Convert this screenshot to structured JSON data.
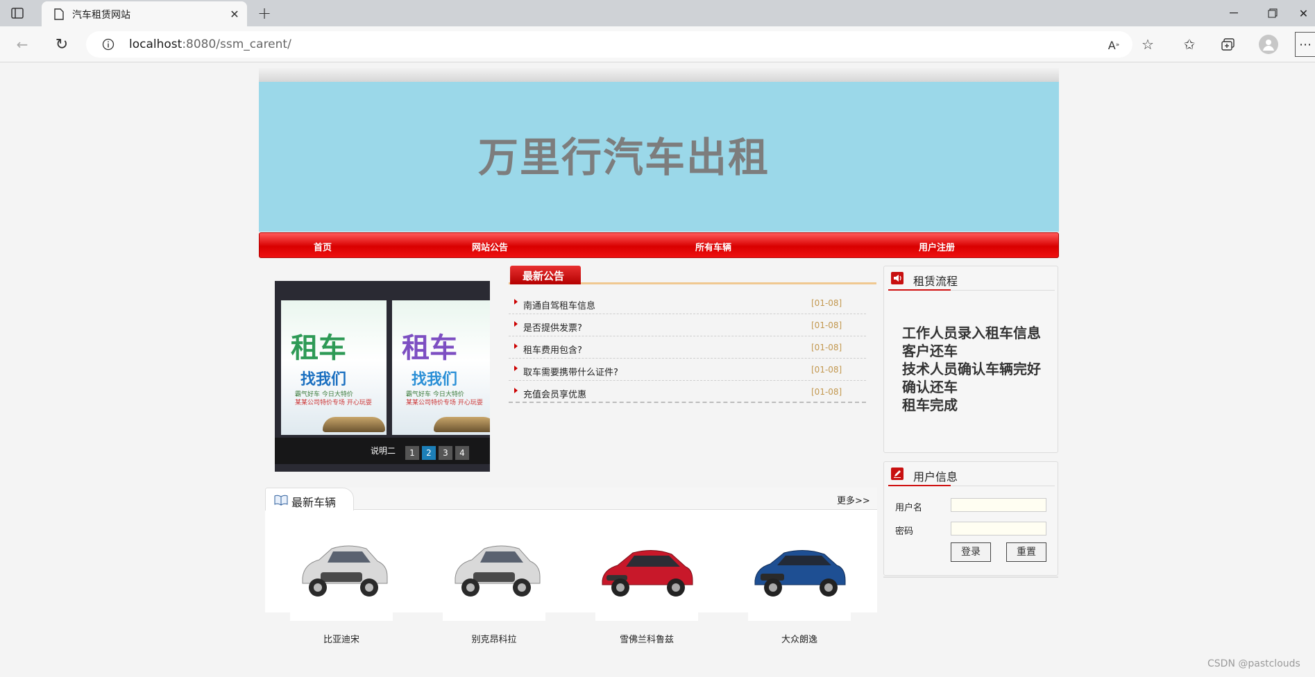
{
  "browser": {
    "tab_title": "汽车租赁网站",
    "url_host": "localhost",
    "url_rest": ":8080/ssm_carent/"
  },
  "header": {
    "site_title": "万里行汽车出租"
  },
  "nav": {
    "items": [
      {
        "label": "首页"
      },
      {
        "label": "网站公告"
      },
      {
        "label": "所有车辆"
      },
      {
        "label": "用户注册"
      }
    ]
  },
  "slider": {
    "caption": "说明二",
    "pages": [
      "1",
      "2",
      "3",
      "4"
    ],
    "active_page": 2,
    "poster_text": [
      "租车",
      "找我们",
      "霸气好车 今日大特价",
      "某某公司特价专场 开心玩耍"
    ]
  },
  "notices": {
    "title": "最新公告",
    "items": [
      {
        "text": "南通自驾租车信息",
        "date": "[01-08]"
      },
      {
        "text": "是否提供发票?",
        "date": "[01-08]"
      },
      {
        "text": "租车费用包含?",
        "date": "[01-08]"
      },
      {
        "text": "取车需要携带什么证件?",
        "date": "[01-08]"
      },
      {
        "text": "充值会员享优惠",
        "date": "[01-08]"
      }
    ]
  },
  "process": {
    "title": "租赁流程",
    "lines": [
      "工作人员录入租车信息",
      "客户还车",
      "技术人员确认车辆完好",
      "确认还车",
      "租车完成"
    ]
  },
  "user_info": {
    "title": "用户信息",
    "username_label": "用户名",
    "password_label": "密码",
    "login_label": "登录",
    "reset_label": "重置"
  },
  "latest_cars": {
    "title": "最新车辆",
    "more": "更多>>",
    "cars": [
      {
        "name": "比亚迪宋",
        "color": "#d9d9d9"
      },
      {
        "name": "别克昂科拉",
        "color": "#d9d9d9"
      },
      {
        "name": "雪佛兰科鲁兹",
        "color": "#c8182a"
      },
      {
        "name": "大众朗逸",
        "color": "#1e4f93"
      }
    ]
  },
  "watermark": "CSDN @pastclouds"
}
